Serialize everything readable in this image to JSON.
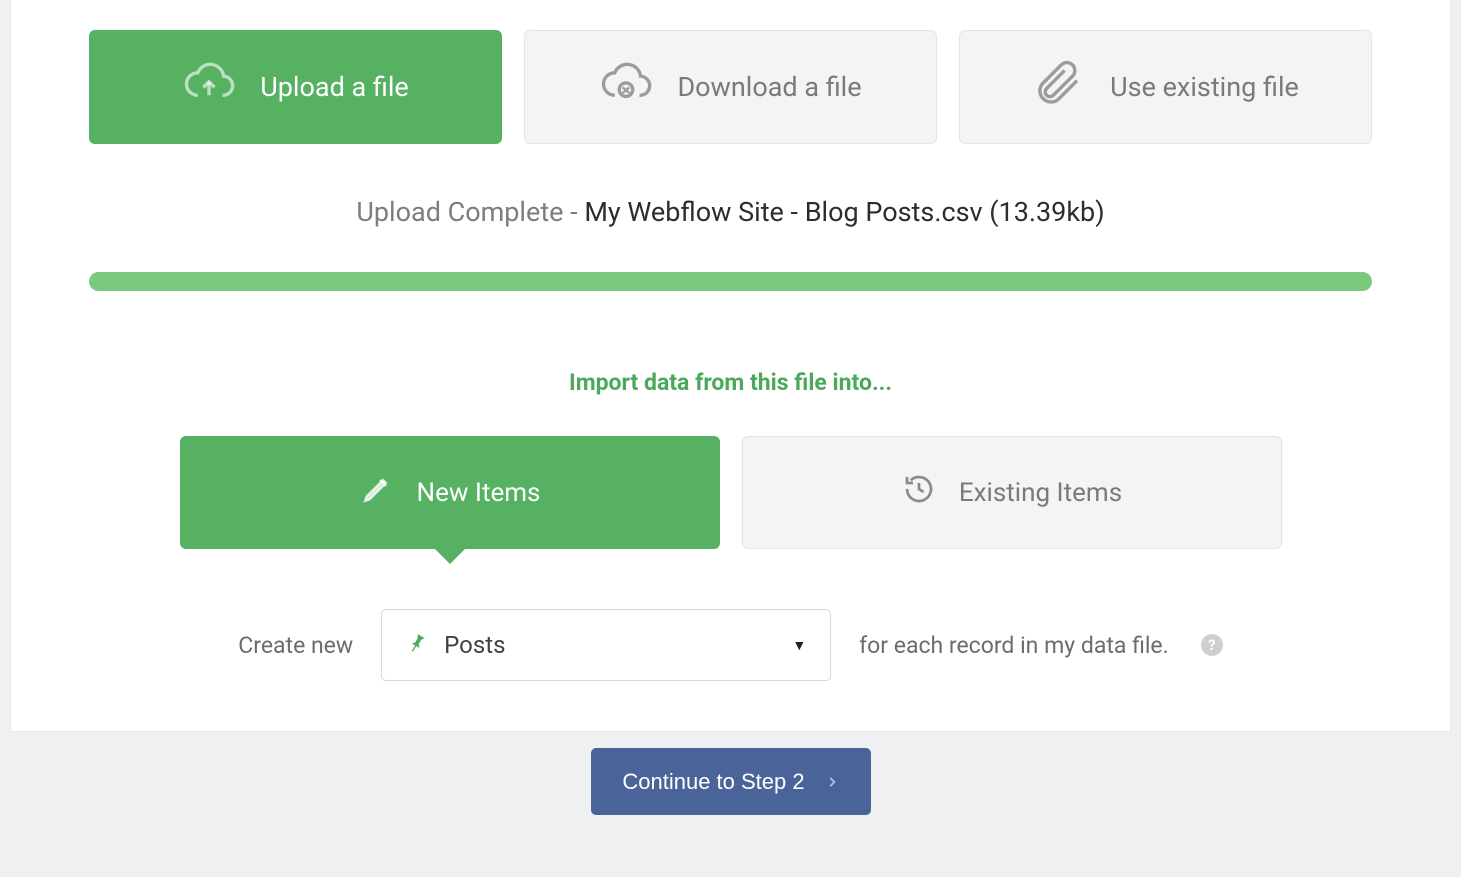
{
  "file_options": {
    "upload": "Upload a file",
    "download": "Download a file",
    "existing": "Use existing file"
  },
  "upload": {
    "status_prefix": "Upload Complete",
    "separator": " - ",
    "file_name": "My Webflow Site - Blog Posts.csv",
    "size": "(13.39kb)"
  },
  "import_heading": "Import data from this file into...",
  "item_options": {
    "new": "New Items",
    "existing": "Existing Items"
  },
  "create_row": {
    "left": "Create new",
    "selected": "Posts",
    "right": "for each record in my data file.",
    "help": "?"
  },
  "footer": {
    "continue": "Continue to Step 2"
  }
}
